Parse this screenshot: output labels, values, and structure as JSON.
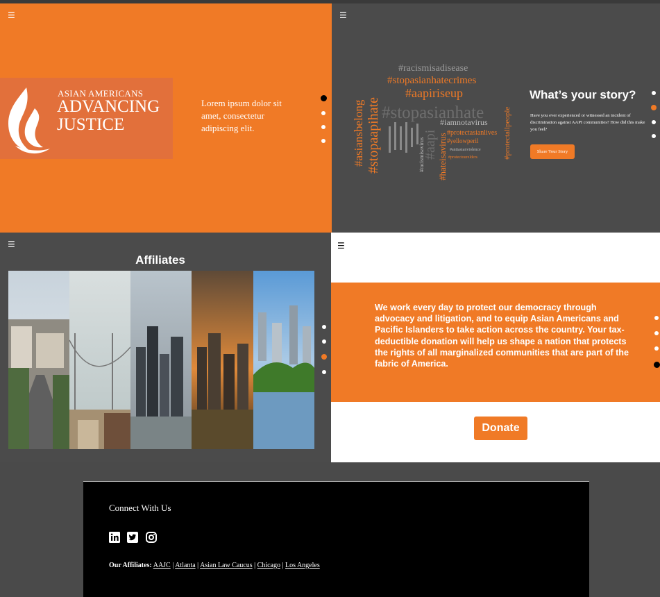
{
  "colors": {
    "orange": "#f07a26",
    "dark_gray": "#4b4b4b",
    "black": "#000000",
    "white": "#ffffff"
  },
  "menu_icon": "☰",
  "hero": {
    "logo": {
      "line1": "ASIAN AMERICANS",
      "line2": "ADVANCING",
      "line3": "JUSTICE"
    },
    "copy": "Lorem ipsum dolor sit amet, consectetur adipiscing elit.",
    "slider_active_index": 0
  },
  "story": {
    "word_cloud": [
      "#racismisadisease",
      "#stopasianhatecrimes",
      "#aapiriseup",
      "#stopasianhate",
      "#asiansbelong",
      "#stopaapihate",
      "#iamnotavirus",
      "#protectasianlives",
      "#yellowperil",
      "#hateisavirus",
      "#protectallpeople",
      "#racismisavirus",
      "#aapi",
      "#antiasianviolence",
      "#protectourelders"
    ],
    "title": "What’s your story?",
    "body": "Have you ever experienced or witnessed an incident of discrimination against AAPI communities? How did this make you feel?",
    "button": "Share Your Story",
    "slider_active_index": 1
  },
  "affiliates_panel": {
    "title": "Affiliates",
    "slider_active_index": 2
  },
  "donate_panel": {
    "body": "We work every day to protect our democracy through advocacy and litigation, and to equip Asian Americans and Pacific Islanders to take action across the country. Your tax-deductible donation will help us shape a nation that protects the rights of all marginalized communities that are part of the fabric of America.",
    "button": "Donate",
    "slider_active_index": 3
  },
  "footer": {
    "connect": "Connect With Us",
    "social_icons": [
      "linkedin-icon",
      "twitter-icon",
      "instagram-icon"
    ],
    "affiliates_label": "Our Affiliates:",
    "affiliates": [
      "AAJC",
      "Atlanta",
      "Asian Law Caucus",
      "Chicago",
      "Los Angeles"
    ],
    "separator": "|"
  }
}
